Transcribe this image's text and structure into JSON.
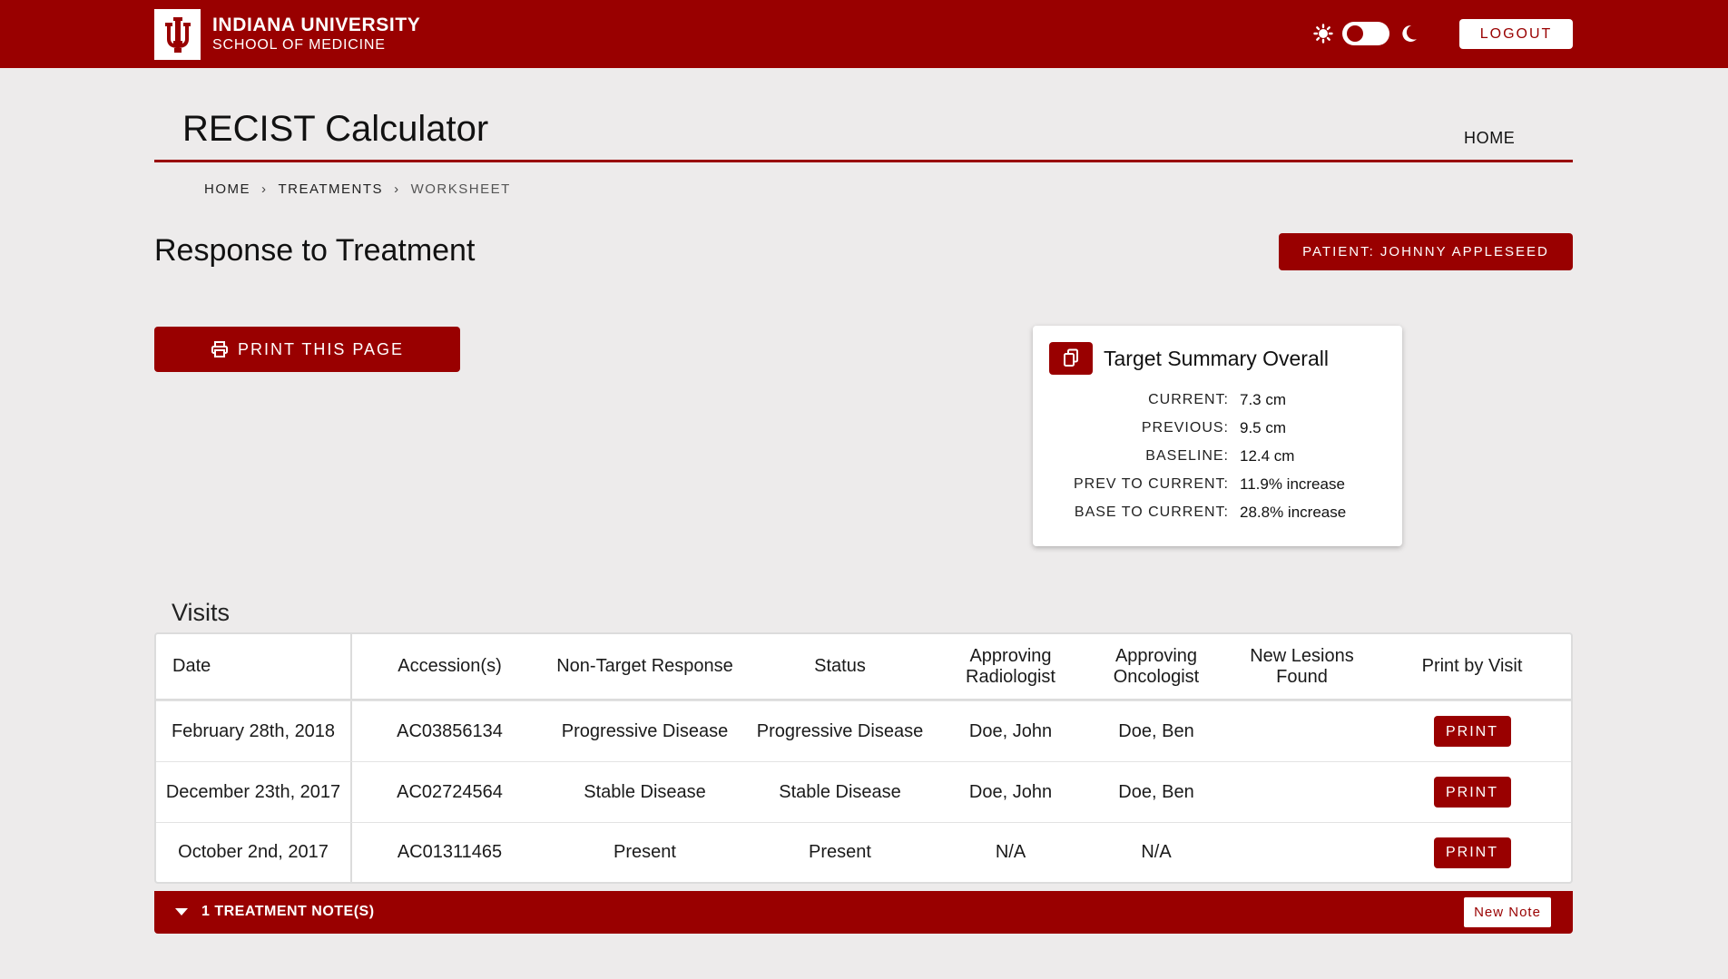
{
  "brand": {
    "line1": "INDIANA UNIVERSITY",
    "line2": "SCHOOL OF MEDICINE",
    "color": "#990000"
  },
  "topbar": {
    "logout_label": "LOGOUT",
    "theme_icons": [
      "sun-icon",
      "moon-icon"
    ]
  },
  "header": {
    "app_title": "RECIST Calculator",
    "home_link": "HOME"
  },
  "breadcrumb": {
    "items": [
      "HOME",
      "TREATMENTS",
      "WORKSHEET"
    ]
  },
  "page": {
    "title": "Response to Treatment",
    "patient_label": "PATIENT: JOHNNY APPLESEED",
    "print_page_label": "PRINT THIS PAGE"
  },
  "summary": {
    "title": "Target Summary Overall",
    "rows": [
      {
        "label": "CURRENT:",
        "value": "7.3 cm"
      },
      {
        "label": "PREVIOUS:",
        "value": "9.5 cm"
      },
      {
        "label": "BASELINE:",
        "value": "12.4 cm"
      },
      {
        "label": "PREV TO CURRENT:",
        "value": "11.9% increase"
      },
      {
        "label": "BASE TO CURRENT:",
        "value": "28.8% increase"
      }
    ]
  },
  "visits": {
    "label": "Visits",
    "columns": [
      "Date",
      "Accession(s)",
      "Non-Target Response",
      "Status",
      "Approving Radiologist",
      "Approving Oncologist",
      "New Lesions Found",
      "Print by Visit"
    ],
    "rows": [
      {
        "date": "February 28th, 2018",
        "accession": "AC03856134",
        "non_target": "Progressive Disease",
        "status": "Progressive Disease",
        "radiologist": "Doe, John",
        "oncologist": "Doe, Ben",
        "new_lesions": "",
        "print_label": "PRINT"
      },
      {
        "date": "December 23th, 2017",
        "accession": "AC02724564",
        "non_target": "Stable Disease",
        "status": "Stable Disease",
        "radiologist": "Doe, John",
        "oncologist": "Doe, Ben",
        "new_lesions": "",
        "print_label": "PRINT"
      },
      {
        "date": "October 2nd, 2017",
        "accession": "AC01311465",
        "non_target": "Present",
        "status": "Present",
        "radiologist": "N/A",
        "oncologist": "N/A",
        "new_lesions": "",
        "print_label": "PRINT"
      }
    ]
  },
  "notes": {
    "toggle_label": "1 TREATMENT NOTE(S)",
    "new_note_label": "New Note"
  }
}
